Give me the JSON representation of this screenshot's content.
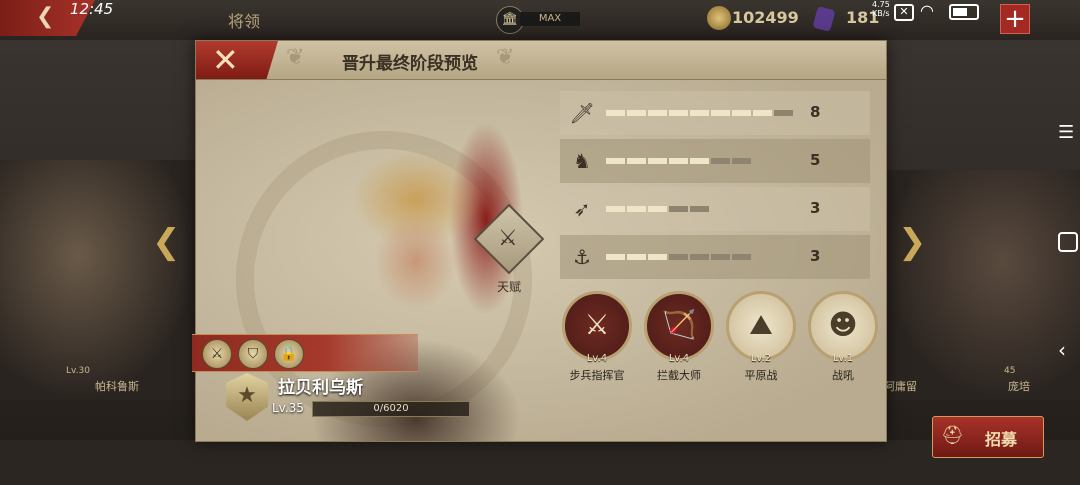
{
  "status_bar": {
    "time": "12:45",
    "net_speed_value": "4.75",
    "net_speed_unit": "KB/s"
  },
  "top_bar": {
    "back_icon": "chevron-left-icon",
    "title": "将领",
    "building_level_label": "MAX",
    "coins": "102499",
    "gems": "181",
    "add_icon": "plus-icon"
  },
  "background": {
    "left_hero_name": "帕科鲁斯",
    "left_hero_level": "Lv.30",
    "right_hero_name_1": "阿庸留",
    "right_hero_name_2": "庞培",
    "right_hero_level": "45"
  },
  "modal": {
    "title": "晋升最终阶段预览",
    "close_icon": "close-icon",
    "hero": {
      "name": "拉贝利乌斯",
      "level": "Lv.35",
      "xp_text": "0/6020",
      "xp_fraction": 0.0
    },
    "talent_label": "天赋",
    "stats": [
      {
        "icon": "sword-icon",
        "value": "8",
        "filled": 8,
        "max": 9
      },
      {
        "icon": "horse-icon",
        "value": "5",
        "filled": 5,
        "max": 7
      },
      {
        "icon": "bow-icon",
        "value": "3",
        "filled": 3,
        "max": 5
      },
      {
        "icon": "anchor-icon",
        "value": "3",
        "filled": 3,
        "max": 7
      }
    ],
    "skills": [
      {
        "icon": "crossed-swords-icon",
        "level": "Lv.4",
        "name": "步兵指挥官"
      },
      {
        "icon": "archer-icon",
        "level": "Lv.4",
        "name": "拦截大师"
      },
      {
        "icon": "plains-icon",
        "level": "Lv.2",
        "name": "平原战"
      },
      {
        "icon": "war-cry-icon",
        "level": "Lv.1",
        "name": "战吼"
      }
    ]
  },
  "recruit_button_label": "招募",
  "colors": {
    "accent_red": "#a8322a",
    "gold": "#c9a85a",
    "parchment": "#cfc4aa"
  }
}
